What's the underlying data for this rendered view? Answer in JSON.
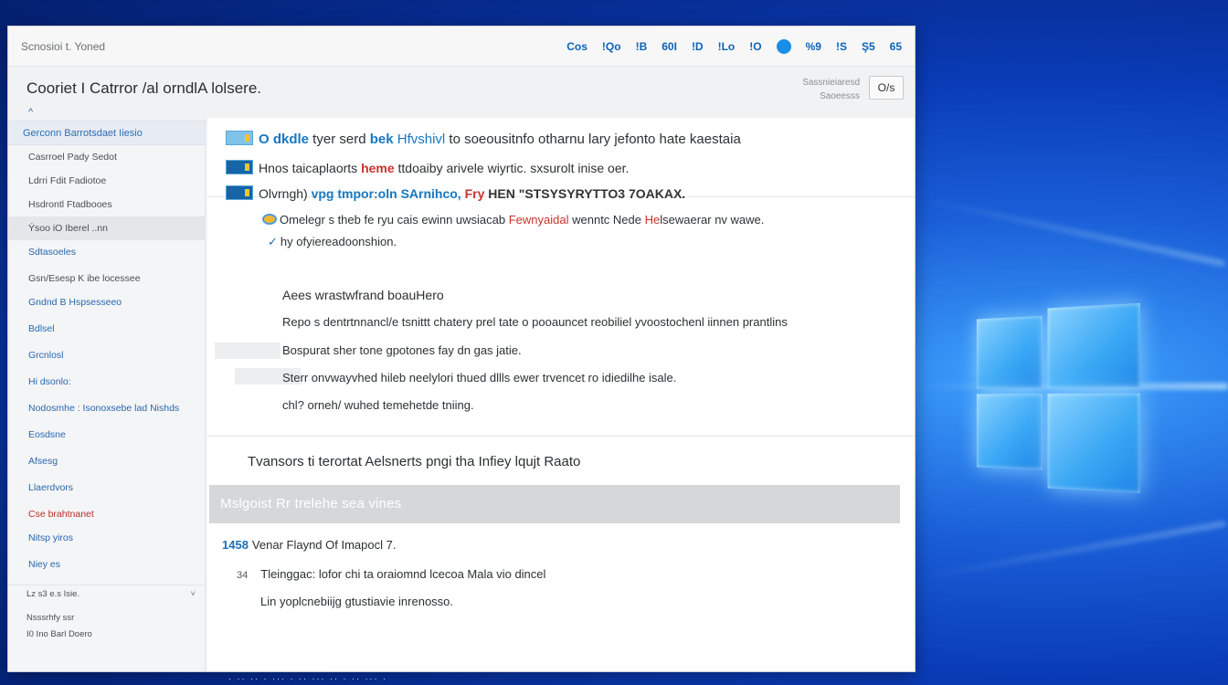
{
  "window": {
    "app_title": "Scnosioi t. Yoned",
    "toolbar": [
      "Cos",
      "!Qo",
      "!B",
      "60I",
      "!D",
      "!Lo",
      "!O",
      "",
      "%9",
      "!S",
      "Ş5",
      "65"
    ],
    "doc_title": "Cooriet I Catrror /al orndlA lolsere.",
    "header_meta_1": "Sassnieiaresd",
    "header_meta_2": "Saoeesss",
    "header_button": "O/s"
  },
  "sidebar": {
    "header": "Gerconn Barrotsdaet Iiesio",
    "items": [
      {
        "label": "Casrroel Pady Sedot",
        "style": "plain"
      },
      {
        "label": "Ldrri Fdit Fadiotoe",
        "style": "plain"
      },
      {
        "label": "Hsdrontl Ftadbooes",
        "style": "plain"
      },
      {
        "label": "Ýsoo iO Iberel ..nn",
        "style": "sel"
      },
      {
        "label": "Sdtasoeles",
        "style": "blue"
      },
      {
        "label": "Gsn/Esesp K ibe locessee",
        "style": "plain"
      },
      {
        "label": "Gndnd B Hspsesseeo",
        "style": "blue"
      },
      {
        "label": "Bdlsel",
        "style": "blue"
      },
      {
        "label": "Grcnlosl",
        "style": "blue"
      },
      {
        "label": "Hi dsonlo:",
        "style": "blue"
      },
      {
        "label": "Nodosmhe : Isonoxsebe lad Nishds",
        "style": "blue"
      },
      {
        "label": "Eosdsne",
        "style": "blue"
      },
      {
        "label": "Afsesg",
        "style": "blue"
      },
      {
        "label": "Llaerdvors",
        "style": "blue"
      },
      {
        "label": "Cse brahtnanet",
        "style": "red"
      },
      {
        "label": "Nitsp yiros",
        "style": "blue"
      },
      {
        "label": "Niey es",
        "style": "blue"
      }
    ],
    "footer": [
      "Lz s3 e.s Isie.",
      "Nsssrhfy ssr",
      "I0 Ino Barl Doero"
    ]
  },
  "main": {
    "line1_kw": "O dkdle",
    "line1_text": " tyer serd ",
    "line1_kw2": "bek",
    "line1_link": " Hfvshivl ",
    "line1_rest": "to soeousitnfo otharnu lary jefonto hate kaestaia",
    "line2_pre": "Hnos taicaplaorts ",
    "line2_red": "heme",
    "line2_rest": " ttdoaiby arivele wiyrtic. sxsurolt inise oer.",
    "line3_pre": "Olvrngh) ",
    "line3_kw": "vpg tmpor:oln",
    "line3_mid": "  SArnihco, ",
    "line3_red": "Fry",
    "line3_dark": " HEN  \"STSYSYRYTTO3 7OAKAX.",
    "line4_pre": "Omelegr  s theb fe ryu cais ewinn uwsiacab ",
    "line4_red": "Fewnyaidal",
    "line4_mid": " wenntc Nede ",
    "line4_red2": "He",
    "line4_rest": "lsewaerar nv wawe.",
    "line5": "hy ofyiereadoonshion.",
    "line6": "Aees wrastwfrand boauHero",
    "line7": "Repo s dentrtnnancl/e tsnittt chatery prel tate o pooauncet reobiliel yvoostochenl iinnen prantlins",
    "line8": "Bospurat sher tone gpotones fay dn gas jatie.",
    "line9": "Sterr onvwayvhed hileb neelylori thued dllls ewer trvencet ro idiedilhe isale.",
    "line10": "chl? orneh/ wuhed temehetde tniing.",
    "summary": "Tvansors ti terortat Aelsnerts pngi tha Infiey lqujt Raato",
    "banner": "Mslgoist Rr trelehe sea vines",
    "num1_value": "1458",
    "num1_text": "Venar Flaynd Of Imapocl 7.",
    "num2_value": "34",
    "num2_text": "Tleinggac: lofor chi ta oraiomnd lcecoa Mala vio dincel",
    "num3_text": "Lin yoplcnebiijg gtustiavie inrenosso."
  },
  "taskbar": {
    "text": "· ·· ·· · ··· · ·· ··· ·· · ·· ··· ·"
  }
}
